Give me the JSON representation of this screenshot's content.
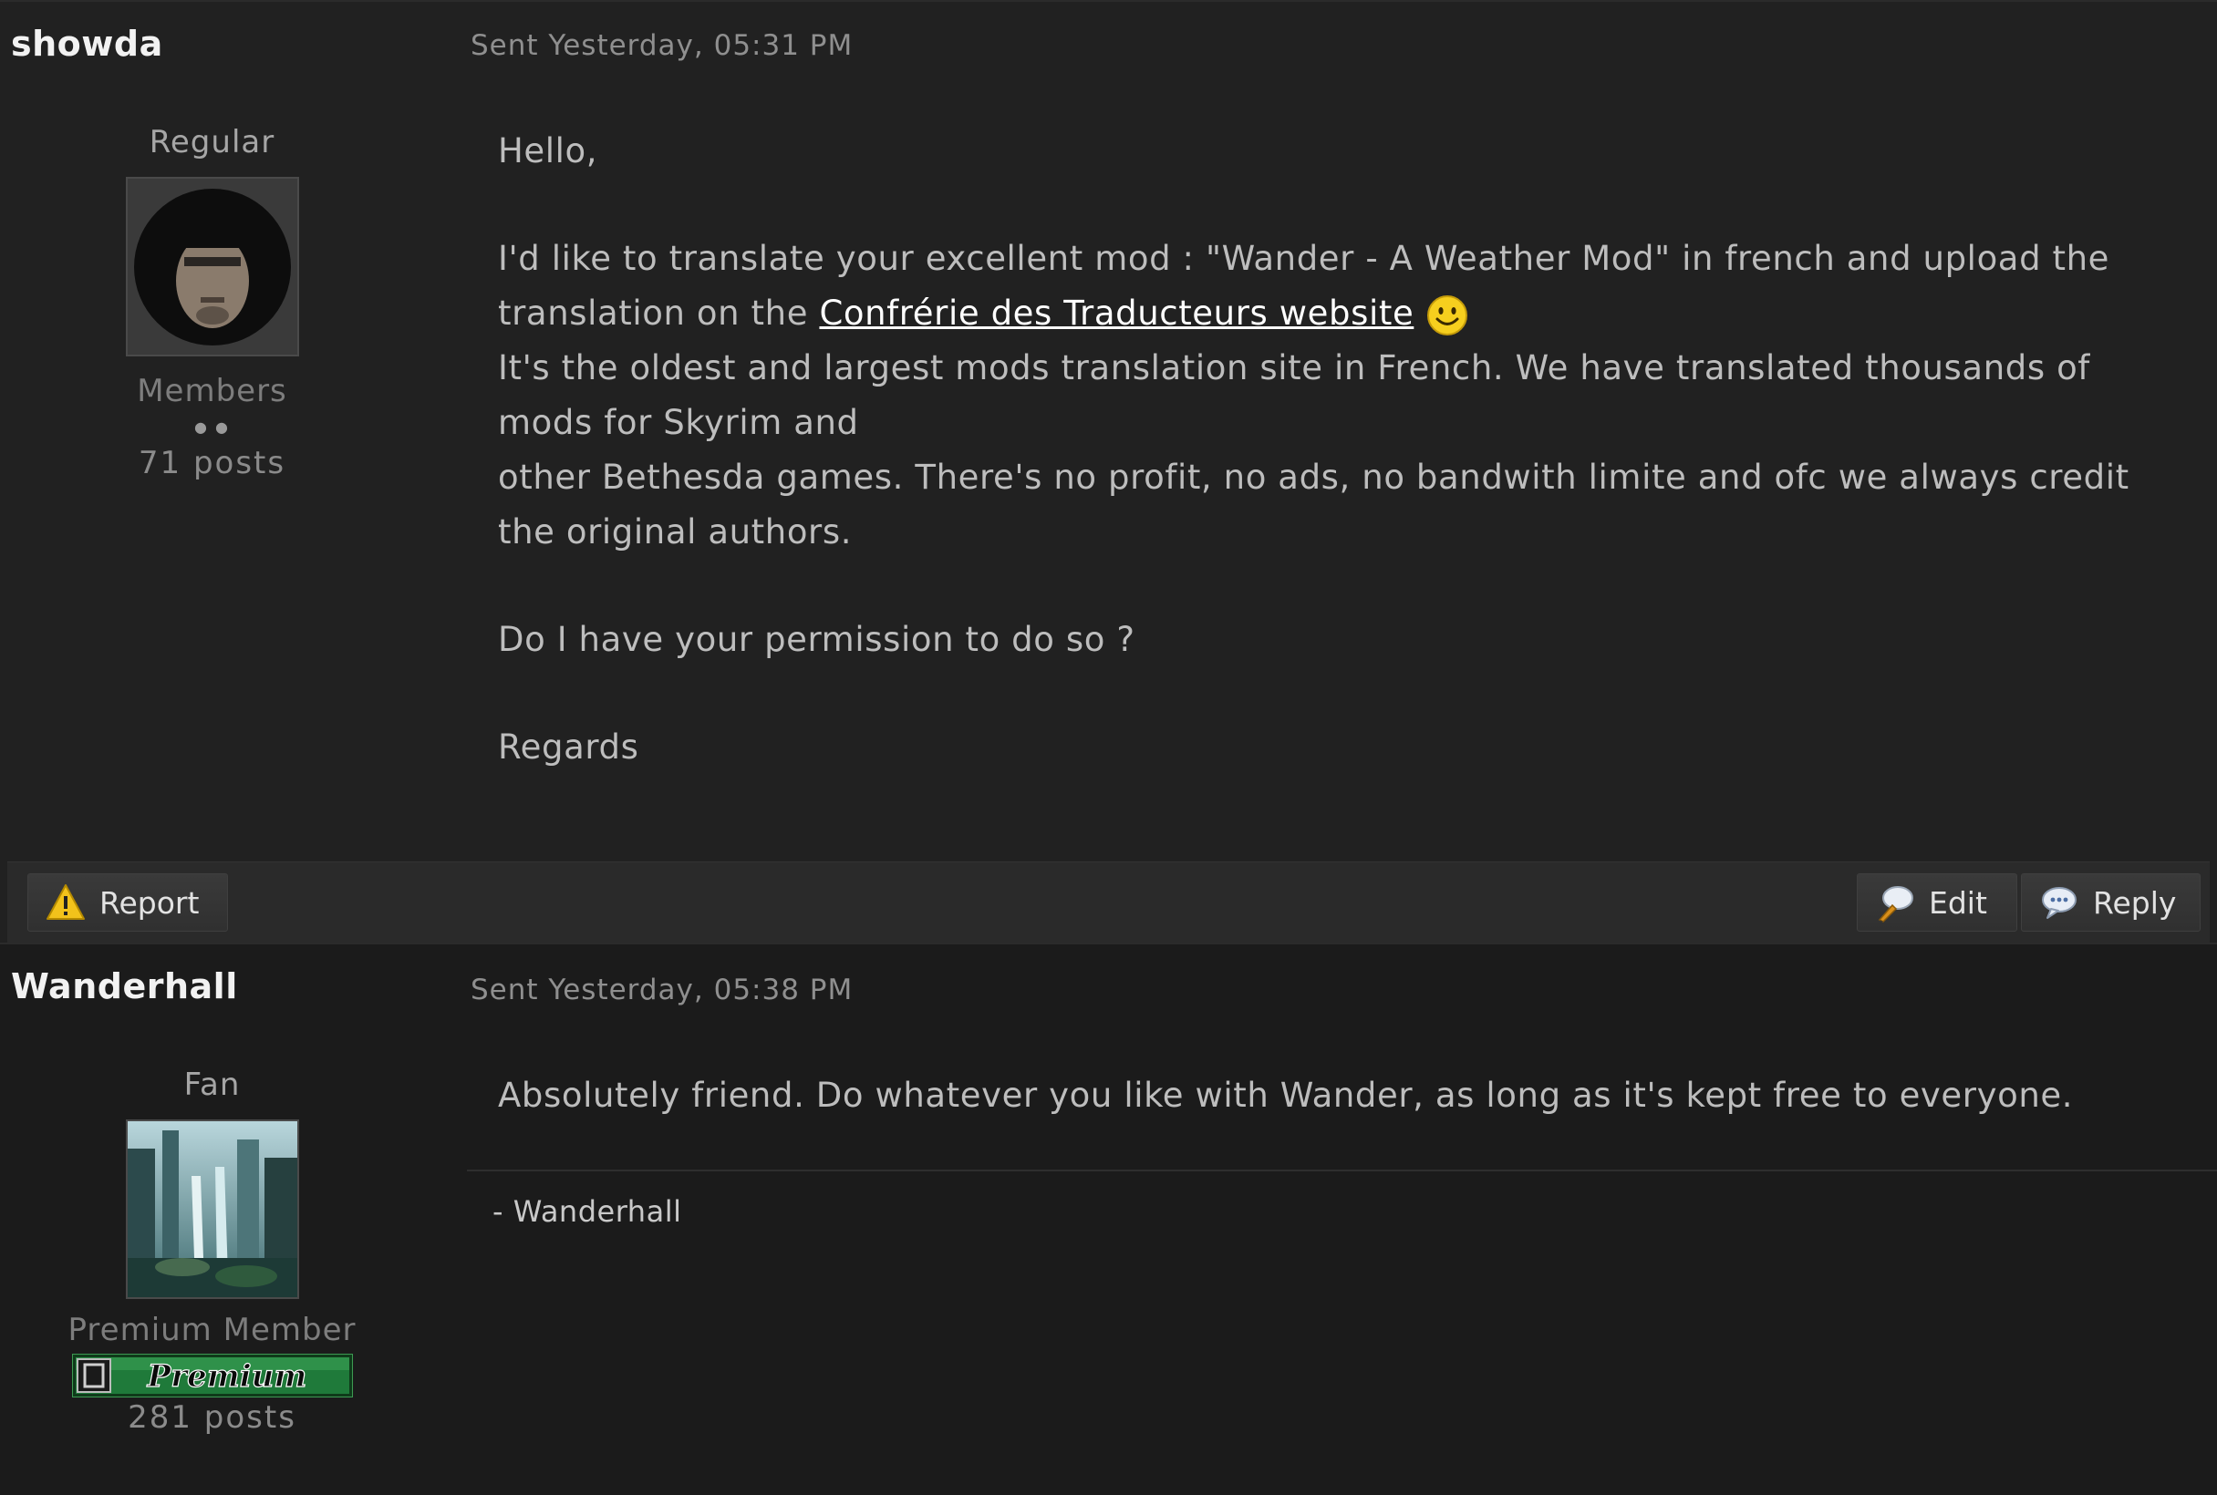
{
  "posts": [
    {
      "author": "showda",
      "sent": "Sent Yesterday, 05:31 PM",
      "rank": "Regular",
      "group": "Members",
      "rank_pips": "● ●",
      "post_count": "71 posts",
      "body": {
        "greeting": "Hello,",
        "line1": "I'd like to translate your excellent mod : \"Wander - A Weather Mod\" in french and upload the",
        "line2_prefix": "translation on the ",
        "link_text": "Confrérie des Traducteurs website",
        "line3": "It's the oldest and largest mods translation site in French. We have translated thousands of mods for Skyrim and",
        "line4": "other Bethesda games. There's no profit, no ads, no bandwith limite and ofc we always credit the original authors.",
        "question": "Do I have your permission to do so ?",
        "closing": "Regards"
      }
    },
    {
      "author": "Wanderhall",
      "sent": "Sent Yesterday, 05:38 PM",
      "rank": "Fan",
      "group": "Premium Member",
      "badge_text": "Premium",
      "post_count": "281 posts",
      "body": {
        "text": "Absolutely friend. Do whatever you like with Wander, as long as it's kept free to everyone."
      },
      "signature": "- Wanderhall"
    }
  ],
  "actions": {
    "report_label": "Report",
    "edit_label": "Edit",
    "reply_label": "Reply"
  },
  "icons": {
    "report": "warning-icon",
    "edit": "edit-icon",
    "reply": "reply-icon",
    "smiley": "smiley-icon"
  },
  "colors": {
    "background": "#1c1c1c",
    "warning": "#f2c21b",
    "badge_green": "#1f7a3a",
    "smiley": "#f6cf1e"
  }
}
